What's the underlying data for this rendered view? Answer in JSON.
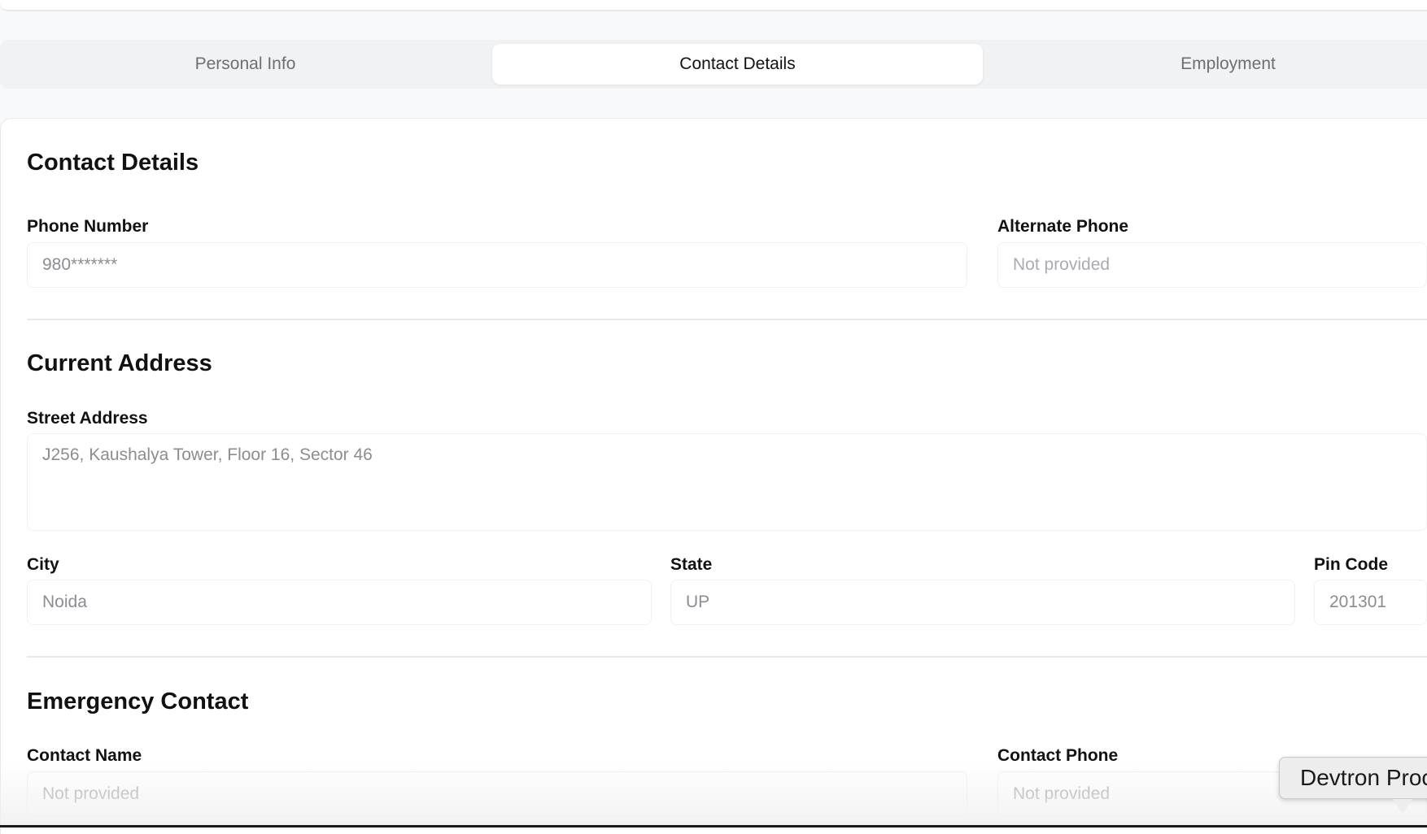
{
  "tabs": [
    {
      "label": "Personal Info"
    },
    {
      "label": "Contact Details"
    },
    {
      "label": "Employment"
    }
  ],
  "contact_details": {
    "title": "Contact Details",
    "phone_label": "Phone Number",
    "phone_value": "980*******",
    "alt_phone_label": "Alternate Phone",
    "alt_phone_value": "Not provided"
  },
  "current_address": {
    "title": "Current Address",
    "street_label": "Street Address",
    "street_value": "J256, Kaushalya Tower, Floor 16, Sector 46",
    "city_label": "City",
    "city_value": "Noida",
    "state_label": "State",
    "state_value": "UP",
    "pin_label": "Pin Code",
    "pin_value": "201301"
  },
  "emergency_contact": {
    "title": "Emergency Contact",
    "name_label": "Contact Name",
    "name_value": "Not provided",
    "phone_label": "Contact Phone",
    "phone_value": "Not provided"
  },
  "tooltip": {
    "text": "Devtron Proc"
  }
}
